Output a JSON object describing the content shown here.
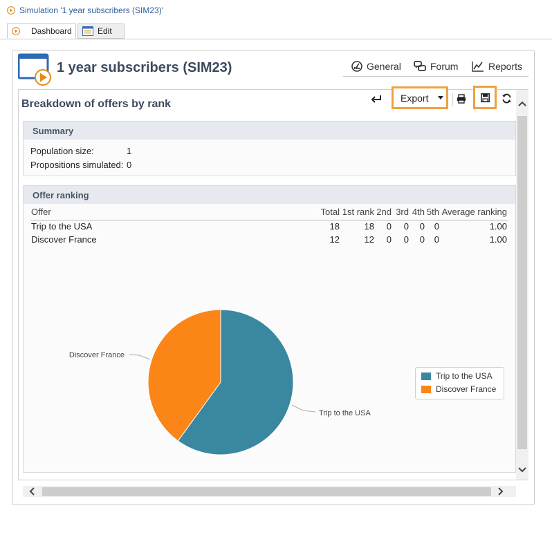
{
  "window": {
    "title": "Simulation '1 year subscribers (SIM23)'"
  },
  "tabs": [
    {
      "label": "Dashboard"
    },
    {
      "label": "Edit"
    }
  ],
  "header": {
    "title": "1 year subscribers (SIM23)"
  },
  "nav": {
    "general": "General",
    "forum": "Forum",
    "reports": "Reports"
  },
  "report": {
    "title": "Breakdown of offers by rank"
  },
  "toolbar": {
    "export_label": "Export"
  },
  "summary": {
    "title": "Summary",
    "population_label": "Population size:",
    "population_value": "1",
    "propositions_label": "Propositions simulated:",
    "propositions_value": "0"
  },
  "ranking": {
    "title": "Offer ranking",
    "columns": [
      "Offer",
      "Total",
      "1st rank",
      "2nd",
      "3rd",
      "4th",
      "5th",
      "Average ranking"
    ],
    "rows": [
      [
        "Trip to the USA",
        "18",
        "18",
        "0",
        "0",
        "0",
        "0",
        "1.00"
      ],
      [
        "Discover France",
        "12",
        "12",
        "0",
        "0",
        "0",
        "0",
        "1.00"
      ]
    ]
  },
  "colors": {
    "accent": "#f0a040",
    "usa": "#3a87a0",
    "france": "#fb8617",
    "link": "#2a5b9e"
  },
  "chart_data": {
    "type": "pie",
    "slices": [
      {
        "label": "Trip to the USA",
        "value": 18,
        "color": "#3a87a0"
      },
      {
        "label": "Discover France",
        "value": 12,
        "color": "#fb8617"
      }
    ],
    "legend": [
      "Trip to the USA",
      "Discover France"
    ],
    "legend_position": "right"
  }
}
